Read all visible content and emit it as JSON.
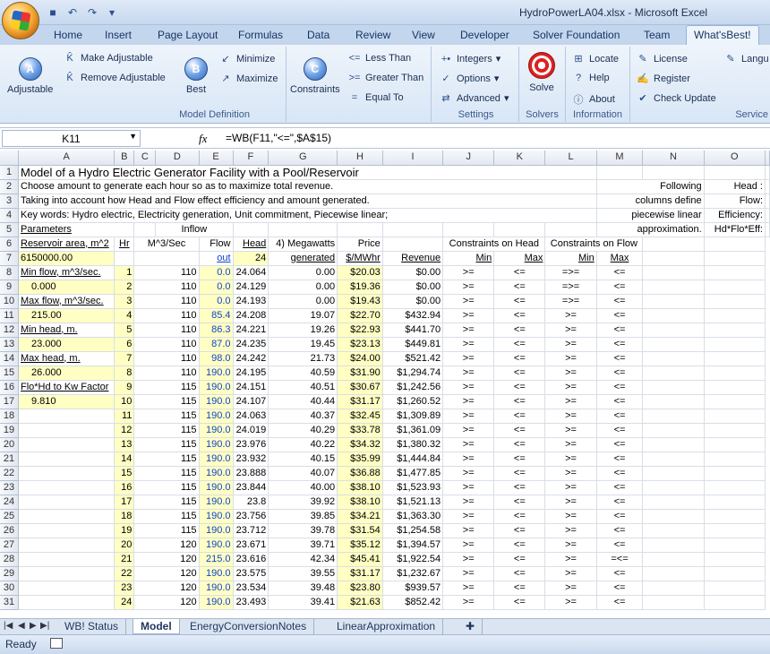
{
  "window": {
    "title": "HydroPowerLA04.xlsx - Microsoft Excel"
  },
  "ribbon_tabs": [
    "Home",
    "Insert",
    "Page Layout",
    "Formulas",
    "Data",
    "Review",
    "View",
    "Developer",
    "Solver Foundation",
    "Team",
    "What'sBest!"
  ],
  "ribbon": {
    "model_definition": {
      "label": "Model Definition",
      "adjustable": "Adjustable",
      "make_adjustable": "Make Adjustable",
      "remove_adjustable": "Remove Adjustable",
      "best": "Best",
      "minimize": "Minimize",
      "maximize": "Maximize",
      "constraints": "Constraints",
      "less_than": "Less Than",
      "greater_than": "Greater Than",
      "equal_to": "Equal To"
    },
    "settings": {
      "label": "Settings",
      "integers": "Integers",
      "options": "Options",
      "advanced": "Advanced"
    },
    "solvers": {
      "label": "Solvers",
      "solve": "Solve"
    },
    "information": {
      "label": "Information",
      "locate": "Locate",
      "help": "Help",
      "about": "About"
    },
    "service": {
      "label": "Service",
      "license": "License",
      "register": "Register",
      "check_update": "Check Update",
      "language": "Langu"
    }
  },
  "formula_bar": {
    "name_box": "K11",
    "fx": "fx",
    "formula": "=WB(F11,\"<=\",$A$15)"
  },
  "columns": [
    "A",
    "B",
    "C",
    "D",
    "E",
    "F",
    "G",
    "H",
    "I",
    "J",
    "K",
    "L",
    "M",
    "N",
    "O"
  ],
  "header_rows": [
    {
      "n": "1",
      "text": "Model of a Hydro Electric Generator Facility with a Pool/Reservoir"
    },
    {
      "n": "2",
      "text": " Choose amount to generate each hour so as to maximize total revenue.",
      "n_text": "Following",
      "o_text": "Head :"
    },
    {
      "n": "3",
      "text": "Taking into account how Head and Flow effect efficiency and amount generated.",
      "n_text": "columns define",
      "o_text": "Flow:"
    },
    {
      "n": "4",
      "text": "Key words:  Hydro electric, Electricity generation, Unit commitment, Piecewise linear;",
      "n_text": "piecewise linear",
      "o_text": "Efficiency:"
    },
    {
      "n": "5",
      "a": "Parameters",
      "d": "Inflow",
      "n_text": "approximation.",
      "o_text": "Hd*Flo*Eff:"
    },
    {
      "n": "6",
      "a": "Reservoir area, m^2",
      "c": "Hr",
      "d": "M^3/Sec",
      "e": "Flow",
      "f": "Head",
      "g": "4) Megawatts",
      "h": "Price",
      "jk": "Constraints on Head",
      "lm": "Constraints on Flow"
    },
    {
      "n": "7",
      "a": "6150000.00",
      "e": "out",
      "f": "24",
      "g": "generated",
      "h": "$/MWhr",
      "i": "Revenue",
      "j": "Min",
      "k": "Max",
      "l": "Min",
      "m": "Max"
    }
  ],
  "param_cells": {
    "8": "Min flow, m^3/sec.",
    "9": "0.000",
    "10": "Max flow, m^3/sec.",
    "11": "215.00",
    "12": "Min head, m.",
    "13": "23.000",
    "14": "Max head, m.",
    "15": "26.000",
    "16": "Flo*Hd to Kw Factor",
    "17": "9.810"
  },
  "data_rows": [
    {
      "row": "8",
      "hr": "1",
      "inflow": "110",
      "flow": "0.0",
      "head": "24.064",
      "mw": "0.00",
      "price": "$20.03",
      "rev": "$0.00",
      "j": ">=",
      "k": "<=",
      "l": "=>=",
      "m": "<="
    },
    {
      "row": "9",
      "hr": "2",
      "inflow": "110",
      "flow": "0.0",
      "head": "24.129",
      "mw": "0.00",
      "price": "$19.36",
      "rev": "$0.00",
      "j": ">=",
      "k": "<=",
      "l": "=>=",
      "m": "<="
    },
    {
      "row": "10",
      "hr": "3",
      "inflow": "110",
      "flow": "0.0",
      "head": "24.193",
      "mw": "0.00",
      "price": "$19.43",
      "rev": "$0.00",
      "j": ">=",
      "k": "<=",
      "l": "=>=",
      "m": "<="
    },
    {
      "row": "11",
      "hr": "4",
      "inflow": "110",
      "flow": "85.4",
      "head": "24.208",
      "mw": "19.07",
      "price": "$22.70",
      "rev": "$432.94",
      "j": ">=",
      "k": "<=",
      "l": ">=",
      "m": "<="
    },
    {
      "row": "12",
      "hr": "5",
      "inflow": "110",
      "flow": "86.3",
      "head": "24.221",
      "mw": "19.26",
      "price": "$22.93",
      "rev": "$441.70",
      "j": ">=",
      "k": "<=",
      "l": ">=",
      "m": "<="
    },
    {
      "row": "13",
      "hr": "6",
      "inflow": "110",
      "flow": "87.0",
      "head": "24.235",
      "mw": "19.45",
      "price": "$23.13",
      "rev": "$449.81",
      "j": ">=",
      "k": "<=",
      "l": ">=",
      "m": "<="
    },
    {
      "row": "14",
      "hr": "7",
      "inflow": "110",
      "flow": "98.0",
      "head": "24.242",
      "mw": "21.73",
      "price": "$24.00",
      "rev": "$521.42",
      "j": ">=",
      "k": "<=",
      "l": ">=",
      "m": "<="
    },
    {
      "row": "15",
      "hr": "8",
      "inflow": "110",
      "flow": "190.0",
      "head": "24.195",
      "mw": "40.59",
      "price": "$31.90",
      "rev": "$1,294.74",
      "j": ">=",
      "k": "<=",
      "l": ">=",
      "m": "<="
    },
    {
      "row": "16",
      "hr": "9",
      "inflow": "115",
      "flow": "190.0",
      "head": "24.151",
      "mw": "40.51",
      "price": "$30.67",
      "rev": "$1,242.56",
      "j": ">=",
      "k": "<=",
      "l": ">=",
      "m": "<="
    },
    {
      "row": "17",
      "hr": "10",
      "inflow": "115",
      "flow": "190.0",
      "head": "24.107",
      "mw": "40.44",
      "price": "$31.17",
      "rev": "$1,260.52",
      "j": ">=",
      "k": "<=",
      "l": ">=",
      "m": "<="
    },
    {
      "row": "18",
      "hr": "11",
      "inflow": "115",
      "flow": "190.0",
      "head": "24.063",
      "mw": "40.37",
      "price": "$32.45",
      "rev": "$1,309.89",
      "j": ">=",
      "k": "<=",
      "l": ">=",
      "m": "<="
    },
    {
      "row": "19",
      "hr": "12",
      "inflow": "115",
      "flow": "190.0",
      "head": "24.019",
      "mw": "40.29",
      "price": "$33.78",
      "rev": "$1,361.09",
      "j": ">=",
      "k": "<=",
      "l": ">=",
      "m": "<="
    },
    {
      "row": "20",
      "hr": "13",
      "inflow": "115",
      "flow": "190.0",
      "head": "23.976",
      "mw": "40.22",
      "price": "$34.32",
      "rev": "$1,380.32",
      "j": ">=",
      "k": "<=",
      "l": ">=",
      "m": "<="
    },
    {
      "row": "21",
      "hr": "14",
      "inflow": "115",
      "flow": "190.0",
      "head": "23.932",
      "mw": "40.15",
      "price": "$35.99",
      "rev": "$1,444.84",
      "j": ">=",
      "k": "<=",
      "l": ">=",
      "m": "<="
    },
    {
      "row": "22",
      "hr": "15",
      "inflow": "115",
      "flow": "190.0",
      "head": "23.888",
      "mw": "40.07",
      "price": "$36.88",
      "rev": "$1,477.85",
      "j": ">=",
      "k": "<=",
      "l": ">=",
      "m": "<="
    },
    {
      "row": "23",
      "hr": "16",
      "inflow": "115",
      "flow": "190.0",
      "head": "23.844",
      "mw": "40.00",
      "price": "$38.10",
      "rev": "$1,523.93",
      "j": ">=",
      "k": "<=",
      "l": ">=",
      "m": "<="
    },
    {
      "row": "24",
      "hr": "17",
      "inflow": "115",
      "flow": "190.0",
      "head": "23.8",
      "mw": "39.92",
      "price": "$38.10",
      "rev": "$1,521.13",
      "j": ">=",
      "k": "<=",
      "l": ">=",
      "m": "<="
    },
    {
      "row": "25",
      "hr": "18",
      "inflow": "115",
      "flow": "190.0",
      "head": "23.756",
      "mw": "39.85",
      "price": "$34.21",
      "rev": "$1,363.30",
      "j": ">=",
      "k": "<=",
      "l": ">=",
      "m": "<="
    },
    {
      "row": "26",
      "hr": "19",
      "inflow": "115",
      "flow": "190.0",
      "head": "23.712",
      "mw": "39.78",
      "price": "$31.54",
      "rev": "$1,254.58",
      "j": ">=",
      "k": "<=",
      "l": ">=",
      "m": "<="
    },
    {
      "row": "27",
      "hr": "20",
      "inflow": "120",
      "flow": "190.0",
      "head": "23.671",
      "mw": "39.71",
      "price": "$35.12",
      "rev": "$1,394.57",
      "j": ">=",
      "k": "<=",
      "l": ">=",
      "m": "<="
    },
    {
      "row": "28",
      "hr": "21",
      "inflow": "120",
      "flow": "215.0",
      "head": "23.616",
      "mw": "42.34",
      "price": "$45.41",
      "rev": "$1,922.54",
      "j": ">=",
      "k": "<=",
      "l": ">=",
      "m": "=<="
    },
    {
      "row": "29",
      "hr": "22",
      "inflow": "120",
      "flow": "190.0",
      "head": "23.575",
      "mw": "39.55",
      "price": "$31.17",
      "rev": "$1,232.67",
      "j": ">=",
      "k": "<=",
      "l": ">=",
      "m": "<="
    },
    {
      "row": "30",
      "hr": "23",
      "inflow": "120",
      "flow": "190.0",
      "head": "23.534",
      "mw": "39.48",
      "price": "$23.80",
      "rev": "$939.57",
      "j": ">=",
      "k": "<=",
      "l": ">=",
      "m": "<="
    },
    {
      "row": "31",
      "hr": "24",
      "inflow": "120",
      "flow": "190.0",
      "head": "23.493",
      "mw": "39.41",
      "price": "$21.63",
      "rev": "$852.42",
      "j": ">=",
      "k": "<=",
      "l": ">=",
      "m": "<="
    }
  ],
  "sheet_tabs": [
    "WB! Status",
    "Model",
    "EnergyConversionNotes",
    "LinearApproximation"
  ],
  "active_sheet": "Model",
  "status": {
    "ready": "Ready"
  }
}
